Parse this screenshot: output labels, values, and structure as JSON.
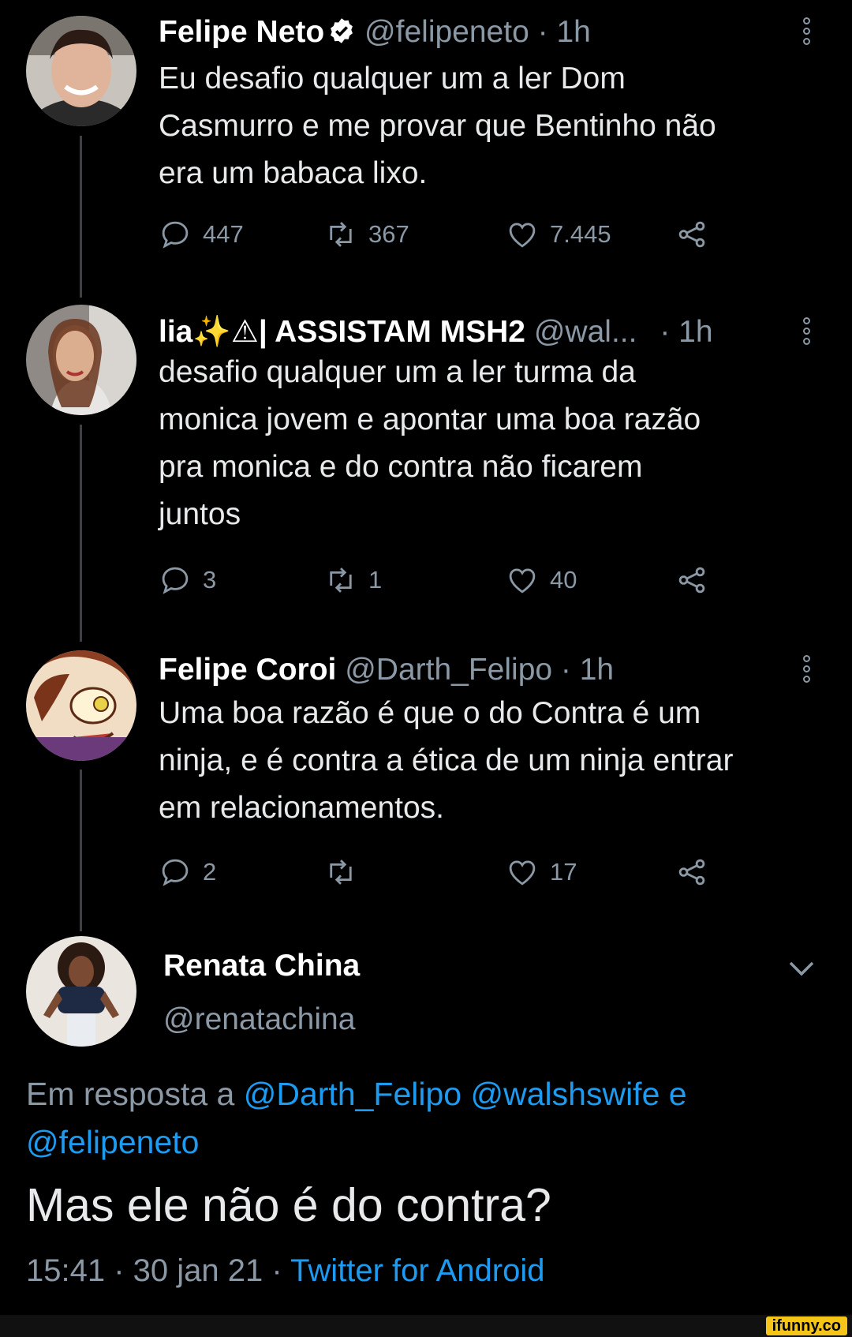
{
  "tweets": [
    {
      "name": "Felipe Neto",
      "handle": "@felipeneto",
      "time": "· 1h",
      "lines": [
        "Eu desafio qualquer um a ler Dom",
        "Casmurro e me provar que Bentinho não",
        "era um babaca lixo."
      ],
      "replies": "447",
      "retweets": "367",
      "likes": "7.445"
    },
    {
      "name": "lia✨⚠| ASSISTAM MSH2",
      "handle": "@wal...",
      "time": "· 1h",
      "lines": [
        "desafio qualquer um a ler turma da",
        "monica jovem e apontar uma boa razão",
        "pra monica e do contra não ficarem",
        "juntos"
      ],
      "replies": "3",
      "retweets": "1",
      "likes": "40"
    },
    {
      "name": "Felipe Coroi",
      "handle": "@Darth_Felipo",
      "time": "· 1h",
      "lines": [
        "Uma boa razão é que o do Contra é um",
        "ninja, e é contra a ética de um ninja entrar",
        "em relacionamentos."
      ],
      "replies": "2",
      "retweets": "",
      "likes": "17"
    }
  ],
  "main_tweet": {
    "name": "Renata China",
    "handle": "@renatachina",
    "reply_prefix": "Em resposta a",
    "reply_handles": [
      "@Darth_Felipo",
      "@walshswife",
      "e",
      "@felipeneto"
    ],
    "text": "Mas ele não é do contra?",
    "time": "15:41",
    "date": "30 jan 21",
    "source": "Twitter for Android"
  },
  "watermark": "ifunny.co",
  "colors": {
    "background": "#000000",
    "link": "#1d9bf0",
    "muted": "#8b98a5"
  }
}
